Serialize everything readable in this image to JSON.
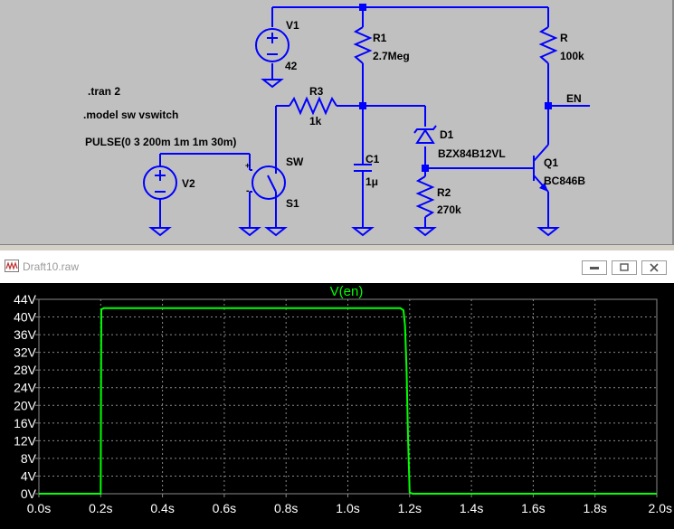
{
  "schematic": {
    "directives": [
      ".tran 2",
      ".model sw vswitch",
      "PULSE(0 3 200m 1m 1m 30m)"
    ],
    "components": {
      "v1": {
        "name": "V1",
        "value": "42"
      },
      "v2": {
        "name": "V2"
      },
      "r1": {
        "name": "R1",
        "value": "2.7Meg"
      },
      "r": {
        "name": "R",
        "value": "100k"
      },
      "r3": {
        "name": "R3",
        "value": "1k"
      },
      "r2": {
        "name": "R2",
        "value": "270k"
      },
      "c1": {
        "name": "C1",
        "value": "1μ"
      },
      "d1": {
        "name": "D1",
        "value": "BZX84B12VL"
      },
      "q1": {
        "name": "Q1",
        "value": "BC846B"
      },
      "s1": {
        "name": "S1",
        "value": "SW"
      }
    },
    "net_label": "EN"
  },
  "waveform_window": {
    "title": "Draft10.raw",
    "buttons": [
      "minimize",
      "restore",
      "close"
    ]
  },
  "chart_data": {
    "type": "line",
    "title": "V(en)",
    "xlabel": "",
    "ylabel": "",
    "x_ticks": [
      "0.0s",
      "0.2s",
      "0.4s",
      "0.6s",
      "0.8s",
      "1.0s",
      "1.2s",
      "1.4s",
      "1.6s",
      "1.8s",
      "2.0s"
    ],
    "y_ticks": [
      "0V",
      "4V",
      "8V",
      "12V",
      "16V",
      "20V",
      "24V",
      "28V",
      "32V",
      "36V",
      "40V",
      "44V"
    ],
    "xlim": [
      0,
      2.0
    ],
    "ylim": [
      0,
      44
    ],
    "grid": true,
    "series": [
      {
        "name": "V(en)",
        "color": "#00ff00",
        "x": [
          0,
          0.2,
          0.202,
          0.21,
          0.5,
          1.0,
          1.17,
          1.18,
          1.185,
          1.19,
          1.195,
          1.2,
          1.21,
          1.4,
          2.0
        ],
        "y": [
          0,
          0,
          41.7,
          42,
          42,
          42,
          42,
          41.5,
          38,
          28,
          12,
          0.3,
          0,
          0,
          0
        ]
      }
    ]
  }
}
